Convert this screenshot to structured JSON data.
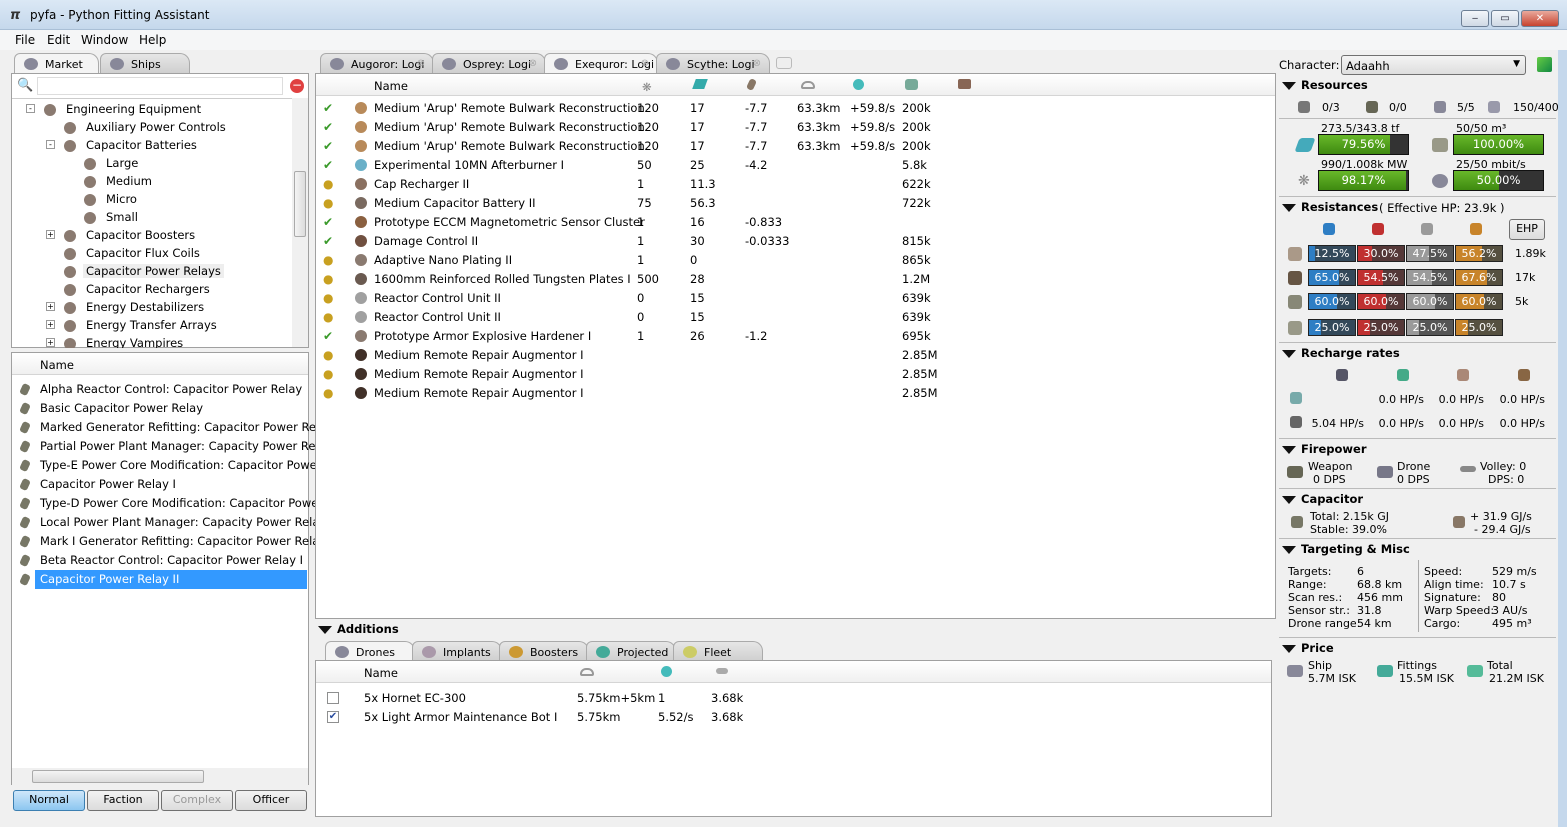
{
  "window": {
    "title": "pyfa - Python Fitting Assistant",
    "min": "‒",
    "max": "▭",
    "close": "✕"
  },
  "menu": [
    "File",
    "Edit",
    "Window",
    "Help"
  ],
  "left": {
    "tabs": [
      "Market",
      "Ships"
    ],
    "search_placeholder": "",
    "tree": [
      {
        "label": "Engineering Equipment",
        "level": 0,
        "exp": "-"
      },
      {
        "label": "Auxiliary Power Controls",
        "level": 1,
        "exp": ""
      },
      {
        "label": "Capacitor Batteries",
        "level": 1,
        "exp": "-"
      },
      {
        "label": "Large",
        "level": 2,
        "exp": ""
      },
      {
        "label": "Medium",
        "level": 2,
        "exp": ""
      },
      {
        "label": "Micro",
        "level": 2,
        "exp": ""
      },
      {
        "label": "Small",
        "level": 2,
        "exp": ""
      },
      {
        "label": "Capacitor Boosters",
        "level": 1,
        "exp": "+"
      },
      {
        "label": "Capacitor Flux Coils",
        "level": 1,
        "exp": ""
      },
      {
        "label": "Capacitor Power Relays",
        "level": 1,
        "exp": "",
        "hover": true
      },
      {
        "label": "Capacitor Rechargers",
        "level": 1,
        "exp": ""
      },
      {
        "label": "Energy Destabilizers",
        "level": 1,
        "exp": "+"
      },
      {
        "label": "Energy Transfer Arrays",
        "level": 1,
        "exp": "+"
      },
      {
        "label": "Energy Vampires",
        "level": 1,
        "exp": "+"
      }
    ],
    "list_header": "Name",
    "items": [
      "Alpha Reactor Control: Capacitor Power Relay",
      "Basic Capacitor Power Relay",
      "Marked Generator Refitting: Capacitor Power Relay",
      "Partial Power Plant Manager: Capacity Power Relay",
      "Type-E Power Core Modification: Capacitor Power",
      "Capacitor Power Relay I",
      "Type-D Power Core Modification: Capacitor Power",
      "Local Power Plant Manager: Capacity Power Relay",
      "Mark I Generator Refitting: Capacitor Power Relay",
      "Beta Reactor Control: Capacitor Power Relay I",
      "Capacitor Power Relay II"
    ],
    "selected_item": 10,
    "meta_buttons": [
      "Normal",
      "Faction",
      "Complex",
      "Officer"
    ]
  },
  "fits": {
    "tabs": [
      "Augoror: Logi",
      "Osprey: Logi",
      "Exequror: Logi",
      "Scythe: Logi"
    ],
    "active_tab": 2,
    "header_name": "Name",
    "modules": [
      {
        "state": "active",
        "name": "Medium 'Arup' Remote Bulwark Reconstruction",
        "cpu": "120",
        "pg": "17",
        "cap": "-7.7",
        "range": "63.3km",
        "rep": "+59.8/s",
        "price": "200k",
        "color": "#b88a5a"
      },
      {
        "state": "active",
        "name": "Medium 'Arup' Remote Bulwark Reconstruction",
        "cpu": "120",
        "pg": "17",
        "cap": "-7.7",
        "range": "63.3km",
        "rep": "+59.8/s",
        "price": "200k",
        "color": "#b88a5a"
      },
      {
        "state": "active",
        "name": "Medium 'Arup' Remote Bulwark Reconstruction",
        "cpu": "120",
        "pg": "17",
        "cap": "-7.7",
        "range": "63.3km",
        "rep": "+59.8/s",
        "price": "200k",
        "color": "#b88a5a"
      },
      {
        "state": "active",
        "name": "Experimental 10MN Afterburner I",
        "cpu": "50",
        "pg": "25",
        "cap": "-4.2",
        "range": "",
        "rep": "",
        "price": "5.8k",
        "color": "#6ab0c8"
      },
      {
        "state": "online",
        "name": "Cap Recharger II",
        "cpu": "1",
        "pg": "11.3",
        "cap": "",
        "range": "",
        "rep": "",
        "price": "622k",
        "color": "#8a7060"
      },
      {
        "state": "online",
        "name": "Medium Capacitor Battery II",
        "cpu": "75",
        "pg": "56.3",
        "cap": "",
        "range": "",
        "rep": "",
        "price": "722k",
        "color": "#7a6a60"
      },
      {
        "state": "active",
        "name": "Prototype ECCM Magnetometric Sensor Cluster",
        "cpu": "1",
        "pg": "16",
        "cap": "-0.833",
        "range": "",
        "rep": "",
        "price": "",
        "color": "#8a6040"
      },
      {
        "state": "active",
        "name": "Damage Control II",
        "cpu": "1",
        "pg": "30",
        "cap": "-0.0333",
        "range": "",
        "rep": "",
        "price": "815k",
        "color": "#705040"
      },
      {
        "state": "online",
        "name": "Adaptive Nano Plating II",
        "cpu": "1",
        "pg": "0",
        "cap": "",
        "range": "",
        "rep": "",
        "price": "865k",
        "color": "#8a7a70"
      },
      {
        "state": "online",
        "name": "1600mm Reinforced Rolled Tungsten Plates I",
        "cpu": "500",
        "pg": "28",
        "cap": "",
        "range": "",
        "rep": "",
        "price": "1.2M",
        "color": "#6a5a50"
      },
      {
        "state": "online",
        "name": "Reactor Control Unit II",
        "cpu": "0",
        "pg": "15",
        "cap": "",
        "range": "",
        "rep": "",
        "price": "639k",
        "color": "#a0a0a0"
      },
      {
        "state": "online",
        "name": "Reactor Control Unit II",
        "cpu": "0",
        "pg": "15",
        "cap": "",
        "range": "",
        "rep": "",
        "price": "639k",
        "color": "#a0a0a0"
      },
      {
        "state": "active",
        "name": "Prototype Armor Explosive Hardener I",
        "cpu": "1",
        "pg": "26",
        "cap": "-1.2",
        "range": "",
        "rep": "",
        "price": "695k",
        "color": "#8a7a70"
      },
      {
        "state": "online",
        "name": "Medium Remote Repair Augmentor I",
        "cpu": "",
        "pg": "",
        "cap": "",
        "range": "",
        "rep": "",
        "price": "2.85M",
        "color": "#403028"
      },
      {
        "state": "online",
        "name": "Medium Remote Repair Augmentor I",
        "cpu": "",
        "pg": "",
        "cap": "",
        "range": "",
        "rep": "",
        "price": "2.85M",
        "color": "#403028"
      },
      {
        "state": "online",
        "name": "Medium Remote Repair Augmentor I",
        "cpu": "",
        "pg": "",
        "cap": "",
        "range": "",
        "rep": "",
        "price": "2.85M",
        "color": "#403028"
      }
    ]
  },
  "additions": {
    "title": "Additions",
    "tabs": [
      "Drones",
      "Implants",
      "Boosters",
      "Projected",
      "Fleet"
    ],
    "header_name": "Name",
    "drones": [
      {
        "checked": false,
        "name": "5x Hornet EC-300",
        "range": "5.75km+5km",
        "rep": "1",
        "price": "3.68k"
      },
      {
        "checked": true,
        "name": "5x Light Armor Maintenance Bot I",
        "range": "5.75km",
        "rep": "5.52/s",
        "price": "3.68k"
      }
    ]
  },
  "stats": {
    "character_label": "Character:",
    "character": "Adaahh",
    "resources": {
      "title": "Resources",
      "turrets": "0/3",
      "launchers": "0/0",
      "drones_active": "5/5",
      "calibration": "150/400",
      "cpu_text": "273.5/343.8 tf",
      "cpu_pct": "79.56%",
      "cpu_fill": 0.7956,
      "dronebay_text": "50/50 m³",
      "dronebay_pct": "100.00%",
      "dronebay_fill": 1.0,
      "pg_text": "990/1.008k MW",
      "pg_pct": "98.17%",
      "pg_fill": 0.9817,
      "bandwidth_text": "25/50 mbit/s",
      "bandwidth_pct": "50.00%",
      "bandwidth_fill": 0.5
    },
    "resistances": {
      "title": "Resistances",
      "ehp_note": "( Effective HP: 23.9k )",
      "ehp_button": "EHP",
      "rows": [
        {
          "layer": "shield",
          "vals": [
            "12.5%",
            "30.0%",
            "47.5%",
            "56.2%"
          ],
          "fills": [
            0.125,
            0.3,
            0.475,
            0.562
          ],
          "ehp": "1.89k"
        },
        {
          "layer": "armor",
          "vals": [
            "65.0%",
            "54.5%",
            "54.5%",
            "67.6%"
          ],
          "fills": [
            0.65,
            0.545,
            0.545,
            0.676
          ],
          "ehp": "17k"
        },
        {
          "layer": "hull",
          "vals": [
            "60.0%",
            "60.0%",
            "60.0%",
            "60.0%"
          ],
          "fills": [
            0.6,
            0.6,
            0.6,
            0.6
          ],
          "ehp": "5k"
        },
        {
          "layer": "damage-pattern",
          "vals": [
            "25.0%",
            "25.0%",
            "25.0%",
            "25.0%"
          ],
          "fills": [
            0.25,
            0.25,
            0.25,
            0.25
          ],
          "ehp": ""
        }
      ],
      "colors": {
        "em": "#2e7ec4",
        "thermal": "#c03030",
        "kinetic": "#9a9a9a",
        "explosive": "#c8842a"
      }
    },
    "recharge": {
      "title": "Recharge rates",
      "rows": [
        [
          "",
          "0.0 HP/s",
          "0.0 HP/s",
          "0.0 HP/s"
        ],
        [
          "5.04 HP/s",
          "0.0 HP/s",
          "0.0 HP/s",
          "0.0 HP/s"
        ]
      ]
    },
    "firepower": {
      "title": "Firepower",
      "weapon_label": "Weapon",
      "weapon": "0 DPS",
      "drone_label": "Drone",
      "drone": "0 DPS",
      "volley": "Volley: 0",
      "dps": "DPS: 0"
    },
    "capacitor": {
      "title": "Capacitor",
      "total": "Total: 2.15k GJ",
      "stable": "Stable: 39.0%",
      "plus": "+ 31.9 GJ/s",
      "minus": "- 29.4 GJ/s"
    },
    "targeting": {
      "title": "Targeting & Misc",
      "left": [
        [
          "Targets:",
          "6"
        ],
        [
          "Range:",
          "68.8 km"
        ],
        [
          "Scan res.:",
          "456 mm"
        ],
        [
          "Sensor str.:",
          "31.8"
        ],
        [
          "Drone range:",
          "54 km"
        ]
      ],
      "right": [
        [
          "Speed:",
          "529 m/s"
        ],
        [
          "Align time:",
          "10.7 s"
        ],
        [
          "Signature:",
          "80"
        ],
        [
          "Warp Speed:",
          "3 AU/s"
        ],
        [
          "Cargo:",
          "495 m³"
        ]
      ]
    },
    "price": {
      "title": "Price",
      "ship_label": "Ship",
      "ship": "5.7M ISK",
      "fittings_label": "Fittings",
      "fittings": "15.5M ISK",
      "total_label": "Total",
      "total": "21.2M ISK"
    }
  }
}
